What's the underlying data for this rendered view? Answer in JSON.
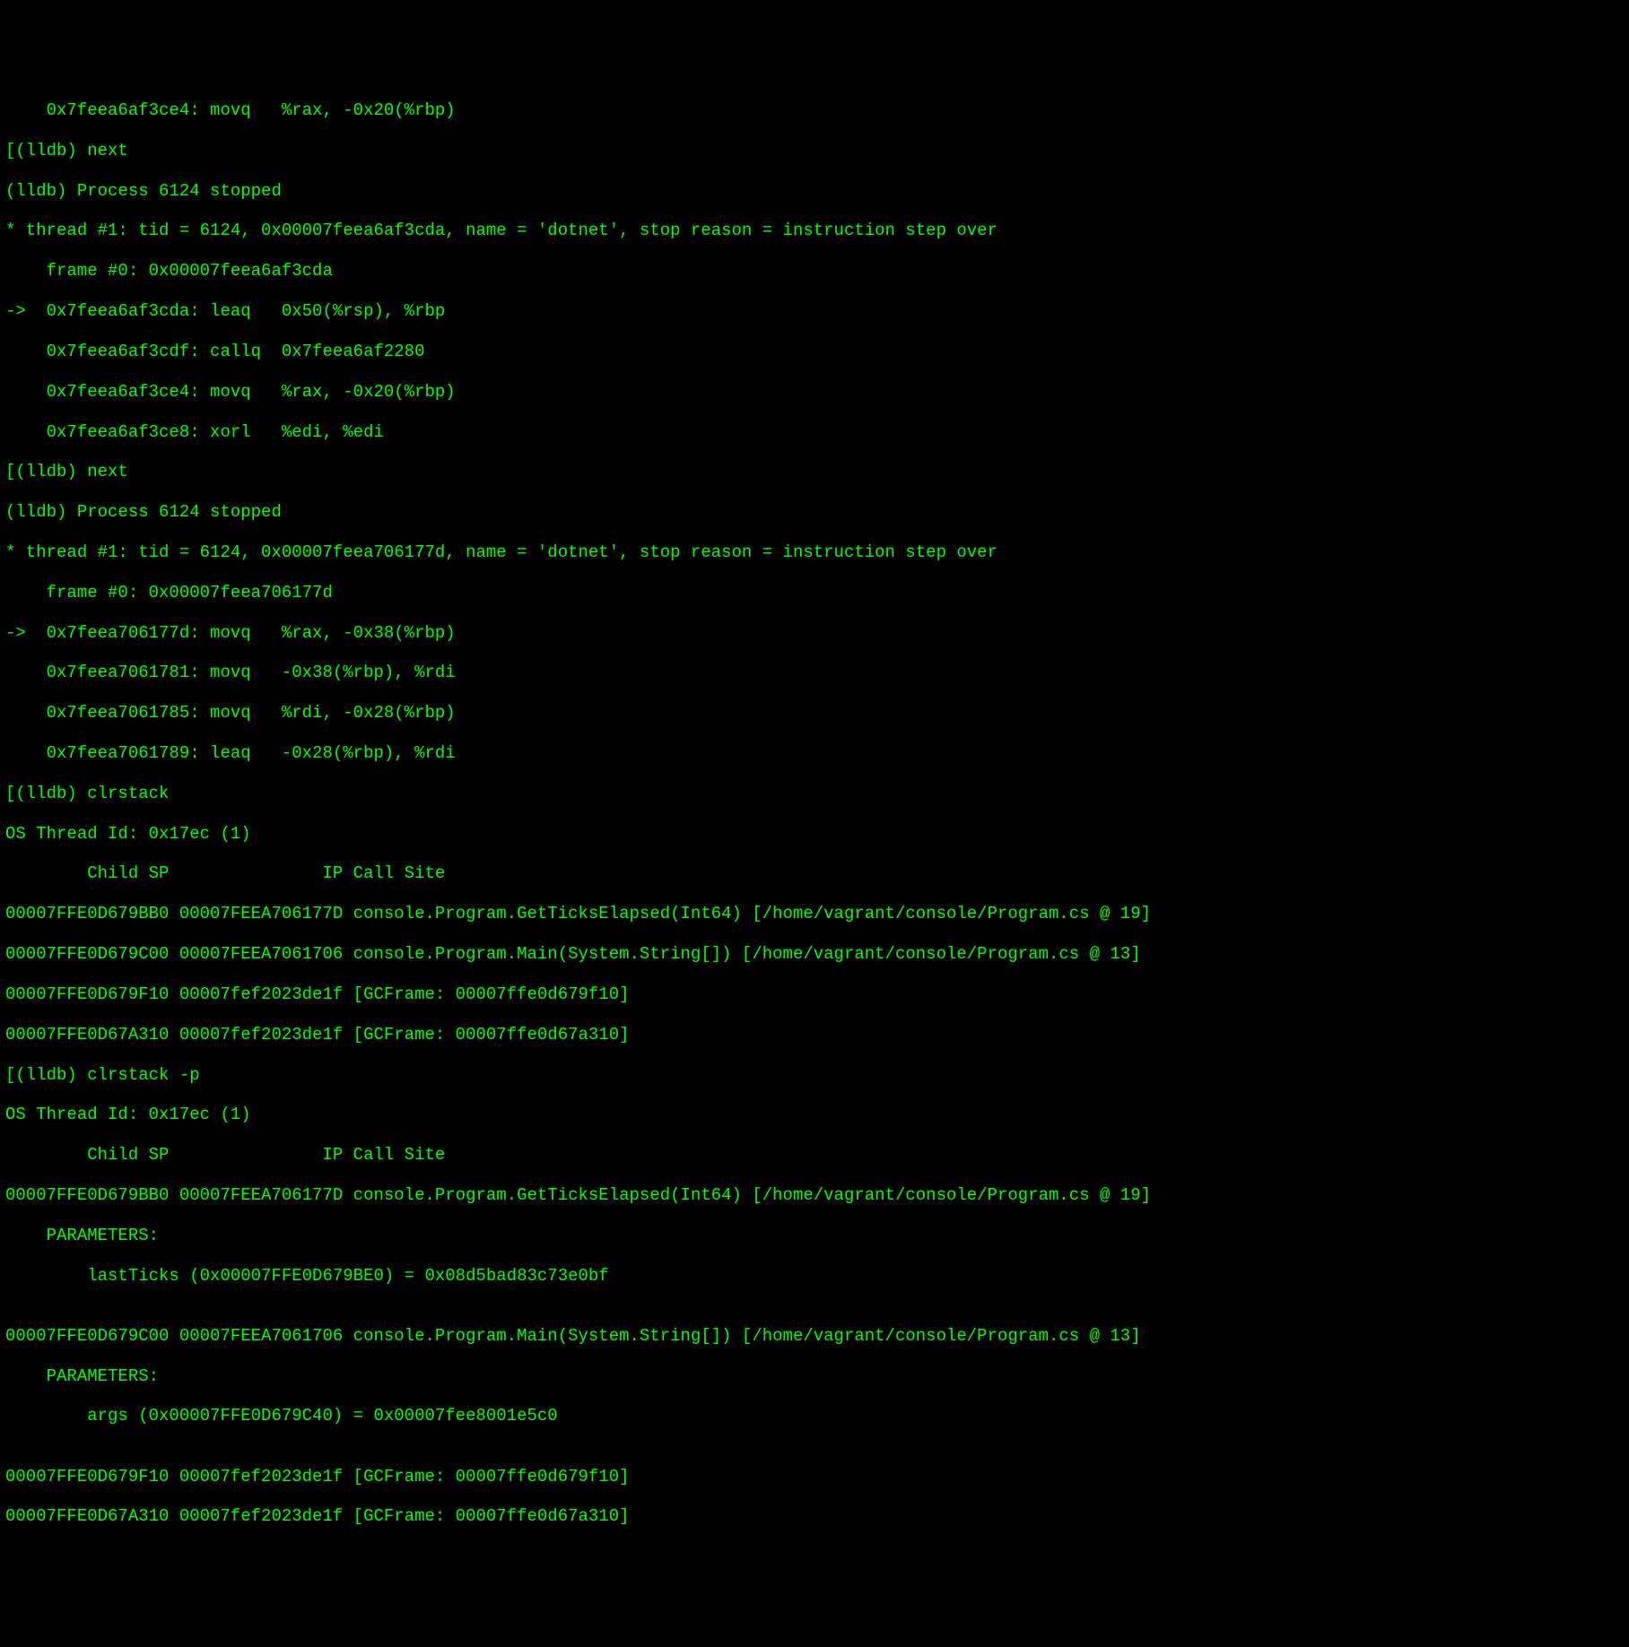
{
  "lines": [
    "    0x7feea6af3ce4: movq   %rax, -0x20(%rbp)",
    "[(lldb) next",
    "(lldb) Process 6124 stopped",
    "* thread #1: tid = 6124, 0x00007feea6af3cda, name = 'dotnet', stop reason = instruction step over",
    "    frame #0: 0x00007feea6af3cda",
    "->  0x7feea6af3cda: leaq   0x50(%rsp), %rbp",
    "    0x7feea6af3cdf: callq  0x7feea6af2280",
    "    0x7feea6af3ce4: movq   %rax, -0x20(%rbp)",
    "    0x7feea6af3ce8: xorl   %edi, %edi",
    "[(lldb) next",
    "(lldb) Process 6124 stopped",
    "* thread #1: tid = 6124, 0x00007feea706177d, name = 'dotnet', stop reason = instruction step over",
    "    frame #0: 0x00007feea706177d",
    "->  0x7feea706177d: movq   %rax, -0x38(%rbp)",
    "    0x7feea7061781: movq   -0x38(%rbp), %rdi",
    "    0x7feea7061785: movq   %rdi, -0x28(%rbp)",
    "    0x7feea7061789: leaq   -0x28(%rbp), %rdi",
    "[(lldb) clrstack",
    "OS Thread Id: 0x17ec (1)",
    "        Child SP               IP Call Site",
    "00007FFE0D679BB0 00007FEEA706177D console.Program.GetTicksElapsed(Int64) [/home/vagrant/console/Program.cs @ 19]",
    "00007FFE0D679C00 00007FEEA7061706 console.Program.Main(System.String[]) [/home/vagrant/console/Program.cs @ 13]",
    "00007FFE0D679F10 00007fef2023de1f [GCFrame: 00007ffe0d679f10]",
    "00007FFE0D67A310 00007fef2023de1f [GCFrame: 00007ffe0d67a310]",
    "[(lldb) clrstack -p",
    "OS Thread Id: 0x17ec (1)",
    "        Child SP               IP Call Site",
    "00007FFE0D679BB0 00007FEEA706177D console.Program.GetTicksElapsed(Int64) [/home/vagrant/console/Program.cs @ 19]",
    "    PARAMETERS:",
    "        lastTicks (0x00007FFE0D679BE0) = 0x08d5bad83c73e0bf",
    "",
    "00007FFE0D679C00 00007FEEA7061706 console.Program.Main(System.String[]) [/home/vagrant/console/Program.cs @ 13]",
    "    PARAMETERS:",
    "        args (0x00007FFE0D679C40) = 0x00007fee8001e5c0",
    "",
    "00007FFE0D679F10 00007fef2023de1f [GCFrame: 00007ffe0d679f10]",
    "00007FFE0D67A310 00007fef2023de1f [GCFrame: 00007ffe0d67a310]"
  ]
}
